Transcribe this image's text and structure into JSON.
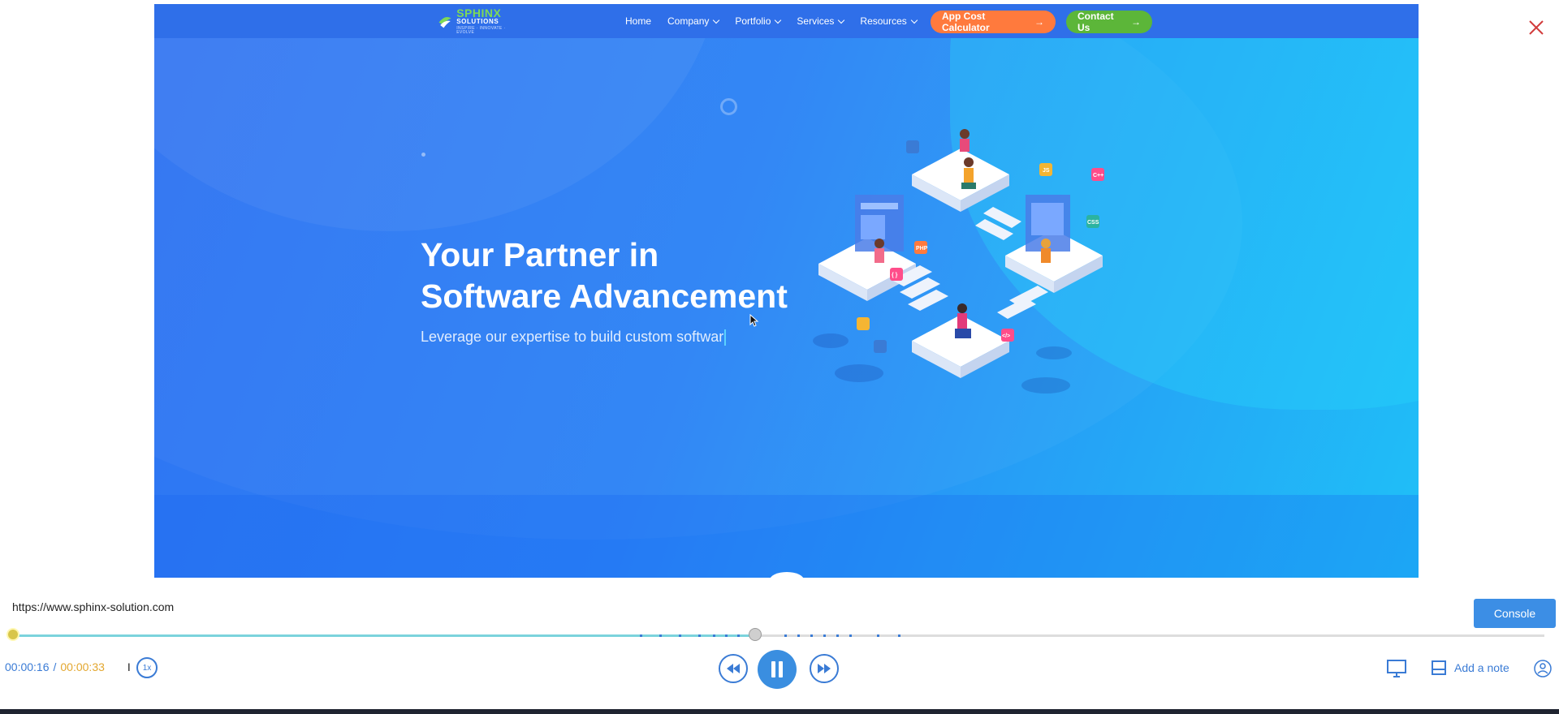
{
  "site": {
    "logo": {
      "name": "SPHINX",
      "sub": "SOLUTIONS",
      "tagline": "INSPIRE · INNOVATE · EVOLVE"
    },
    "nav": [
      {
        "label": "Home",
        "has_dropdown": false
      },
      {
        "label": "Company",
        "has_dropdown": true
      },
      {
        "label": "Portfolio",
        "has_dropdown": true
      },
      {
        "label": "Services",
        "has_dropdown": true
      },
      {
        "label": "Resources",
        "has_dropdown": true
      }
    ],
    "cta_calculator": "App Cost Calculator",
    "cta_contact": "Contact Us",
    "hero": {
      "title_line1": "Your Partner in",
      "title_line2": "Software Advancement",
      "subtitle": "Leverage our expertise to build custom softwar"
    },
    "illustration_tags": [
      "PHP",
      "CSS",
      "C++",
      "JS",
      "</>",
      "{ }"
    ]
  },
  "player": {
    "url": "https://www.sphinx-solution.com",
    "console_label": "Console",
    "time_current": "00:00:16",
    "time_separator": "/",
    "time_total": "00:00:33",
    "cursor_bar": "I",
    "speed": "1x",
    "progress": 0.4848,
    "add_note_label": "Add a note"
  },
  "colors": {
    "hero_gradient_start": "#2f73f2",
    "hero_gradient_end": "#1fc0f7",
    "nav_bg": "#2f6fe9",
    "cta_orange": "#ff7a3d",
    "cta_green": "#5cb639",
    "player_accent": "#3a7bd5",
    "time_total_color": "#e3a72f",
    "close_red": "#d23b3b"
  },
  "icons": {
    "close": "close-icon",
    "rewind": "rewind-icon",
    "pause": "pause-icon",
    "forward": "fast-forward-icon",
    "monitor": "monitor-icon",
    "note": "note-icon",
    "user": "user-icon",
    "speed": "replay-speed-icon"
  }
}
